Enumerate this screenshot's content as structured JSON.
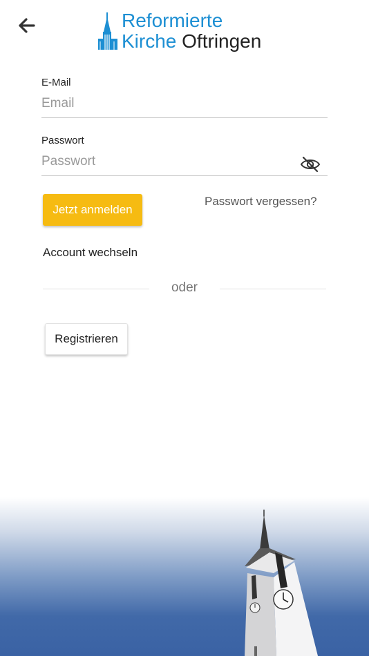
{
  "header": {
    "back_icon": "arrow-left-icon",
    "logo": {
      "line1": "Reformierte",
      "line2_part1": "Kirche",
      "line2_part2": "Oftringen",
      "icon": "church-icon"
    }
  },
  "form": {
    "email": {
      "label": "E-Mail",
      "placeholder": "Email",
      "value": ""
    },
    "password": {
      "label": "Passwort",
      "placeholder": "Passwort",
      "value": "",
      "visibility_icon": "eye-off-icon"
    }
  },
  "actions": {
    "login_label": "Jetzt anmelden",
    "forgot_label": "Passwort vergessen?",
    "switch_account_label": "Account wechseln",
    "divider_label": "oder",
    "register_label": "Registrieren"
  },
  "colors": {
    "brand_blue": "#1d8fd3",
    "login_button": "#f6bb12",
    "footer_blue": "#3a62a4"
  }
}
